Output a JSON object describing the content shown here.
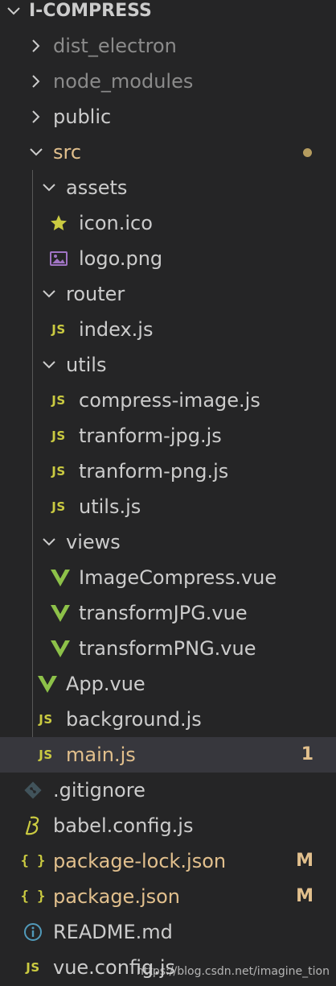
{
  "explorer": {
    "root": {
      "label": "I-COMPRESS",
      "expanded": true
    },
    "items": [
      {
        "label": "dist_electron",
        "kind": "folder",
        "expanded": false,
        "depth": 1,
        "style": "dim"
      },
      {
        "label": "node_modules",
        "kind": "folder",
        "expanded": false,
        "depth": 1,
        "style": "dim"
      },
      {
        "label": "public",
        "kind": "folder",
        "expanded": false,
        "depth": 1,
        "style": "normal"
      },
      {
        "label": "src",
        "kind": "folder",
        "expanded": true,
        "depth": 1,
        "style": "modified",
        "badge": "dot"
      },
      {
        "label": "assets",
        "kind": "folder",
        "expanded": true,
        "depth": 2,
        "style": "normal"
      },
      {
        "label": "icon.ico",
        "kind": "file",
        "icon": "star-icon",
        "depth": 3,
        "style": "normal"
      },
      {
        "label": "logo.png",
        "kind": "file",
        "icon": "image-icon",
        "depth": 3,
        "style": "normal"
      },
      {
        "label": "router",
        "kind": "folder",
        "expanded": true,
        "depth": 2,
        "style": "normal"
      },
      {
        "label": "index.js",
        "kind": "file",
        "icon": "js-icon",
        "depth": 3,
        "style": "normal"
      },
      {
        "label": "utils",
        "kind": "folder",
        "expanded": true,
        "depth": 2,
        "style": "normal"
      },
      {
        "label": "compress-image.js",
        "kind": "file",
        "icon": "js-icon",
        "depth": 3,
        "style": "normal"
      },
      {
        "label": "tranform-jpg.js",
        "kind": "file",
        "icon": "js-icon",
        "depth": 3,
        "style": "normal"
      },
      {
        "label": "tranform-png.js",
        "kind": "file",
        "icon": "js-icon",
        "depth": 3,
        "style": "normal"
      },
      {
        "label": "utils.js",
        "kind": "file",
        "icon": "js-icon",
        "depth": 3,
        "style": "normal"
      },
      {
        "label": "views",
        "kind": "folder",
        "expanded": true,
        "depth": 2,
        "style": "normal"
      },
      {
        "label": "ImageCompress.vue",
        "kind": "file",
        "icon": "vue-icon",
        "depth": 3,
        "style": "normal"
      },
      {
        "label": "transformJPG.vue",
        "kind": "file",
        "icon": "vue-icon",
        "depth": 3,
        "style": "normal"
      },
      {
        "label": "transformPNG.vue",
        "kind": "file",
        "icon": "vue-icon",
        "depth": 3,
        "style": "normal"
      },
      {
        "label": "App.vue",
        "kind": "file",
        "icon": "vue-icon",
        "depth": 2,
        "style": "normal"
      },
      {
        "label": "background.js",
        "kind": "file",
        "icon": "js-icon",
        "depth": 2,
        "style": "normal"
      },
      {
        "label": "main.js",
        "kind": "file",
        "icon": "js-icon",
        "depth": 2,
        "style": "modified",
        "status": "1",
        "selected": true
      },
      {
        "label": ".gitignore",
        "kind": "file",
        "icon": "git-icon",
        "depth": 1,
        "style": "normal"
      },
      {
        "label": "babel.config.js",
        "kind": "file",
        "icon": "babel-icon",
        "depth": 1,
        "style": "normal"
      },
      {
        "label": "package-lock.json",
        "kind": "file",
        "icon": "json-icon",
        "depth": 1,
        "style": "modified",
        "status": "M"
      },
      {
        "label": "package.json",
        "kind": "file",
        "icon": "json-icon",
        "depth": 1,
        "style": "modified",
        "status": "M"
      },
      {
        "label": "README.md",
        "kind": "file",
        "icon": "info-icon",
        "depth": 1,
        "style": "normal"
      },
      {
        "label": "vue.config.js",
        "kind": "file",
        "icon": "js-icon",
        "depth": 1,
        "style": "normal"
      }
    ]
  },
  "icons": {
    "js_text": "JS",
    "json_text": "{ }"
  },
  "colors": {
    "background": "#252526",
    "selected_row": "#37373d",
    "text": "#cccccc",
    "dim_text": "#8b8b8b",
    "modified_text": "#e2c08d",
    "js_yellow": "#cbcb41",
    "vue_green": "#8dc149",
    "image_purple": "#a074c4",
    "info_blue": "#519aba",
    "git_gray": "#41535b"
  },
  "watermark": "https://blog.csdn.net/imagine_tion"
}
